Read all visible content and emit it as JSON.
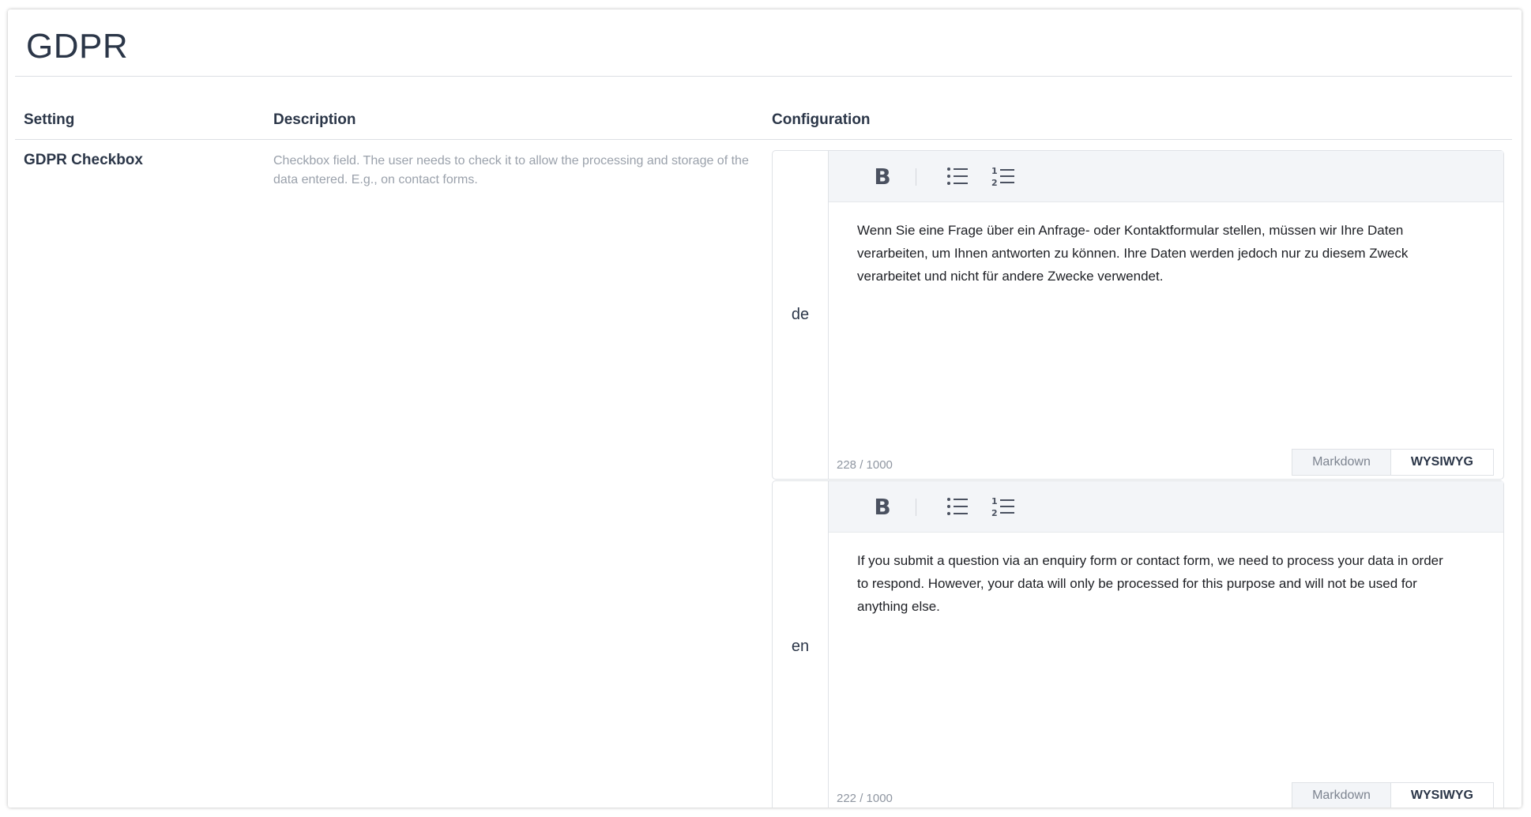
{
  "page": {
    "title": "GDPR"
  },
  "table": {
    "headers": {
      "setting": "Setting",
      "description": "Description",
      "configuration": "Configuration"
    },
    "row": {
      "setting": "GDPR Checkbox",
      "description": "Checkbox field. The user needs to check it to allow the processing and storage of the data entered. E.g., on contact forms."
    }
  },
  "editors": [
    {
      "lang": "de",
      "text": "Wenn Sie eine Frage über ein Anfrage- oder Kontaktformular stellen, müssen wir Ihre Daten verarbeiten, um Ihnen antworten zu können. Ihre Daten werden jedoch nur zu diesem Zweck verarbeitet und nicht für andere Zwecke verwendet.",
      "counter": "228 / 1000",
      "modes": {
        "markdown": "Markdown",
        "wysiwyg": "WYSIWYG"
      },
      "active_mode": "WYSIWYG"
    },
    {
      "lang": "en",
      "text": "If you submit a question via an enquiry form or contact form, we need to process your data in order to respond. However, your data will only be processed for this purpose and will not be used for anything else.",
      "counter": "222 / 1000",
      "modes": {
        "markdown": "Markdown",
        "wysiwyg": "WYSIWYG"
      },
      "active_mode": "WYSIWYG"
    }
  ],
  "toolbar": {
    "bold_glyph": "B",
    "icons": [
      "bold-icon",
      "bullet-list-icon",
      "numbered-list-icon"
    ]
  },
  "colors": {
    "text": "#2b3648",
    "muted": "#9aa1ab",
    "toolbar_bg": "#f3f5f8",
    "border": "#dfe2e6"
  }
}
